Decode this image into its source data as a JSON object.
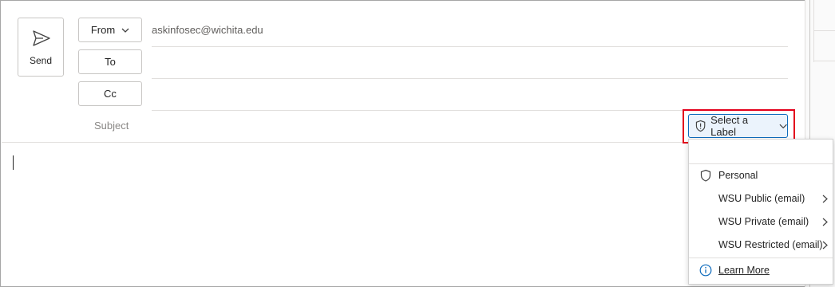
{
  "compose": {
    "send_label": "Send",
    "from_label": "From",
    "from_value": "askinfosec@wichita.edu",
    "to_label": "To",
    "cc_label": "Cc",
    "subject_label": "Subject"
  },
  "sensitivity": {
    "button_label": "Select a Label",
    "items": [
      {
        "label": "Personal",
        "icon": "shield-icon",
        "submenu": false
      },
      {
        "label": "WSU Public (email)",
        "submenu": true
      },
      {
        "label": "WSU Private (email)",
        "submenu": true
      },
      {
        "label": "WSU Restricted (email)",
        "submenu": true
      }
    ],
    "learn_more": "Learn More"
  },
  "colors": {
    "accent": "#0f6cbd",
    "highlight_border": "#e3001b",
    "label_button_bg": "#ebf3fc"
  }
}
